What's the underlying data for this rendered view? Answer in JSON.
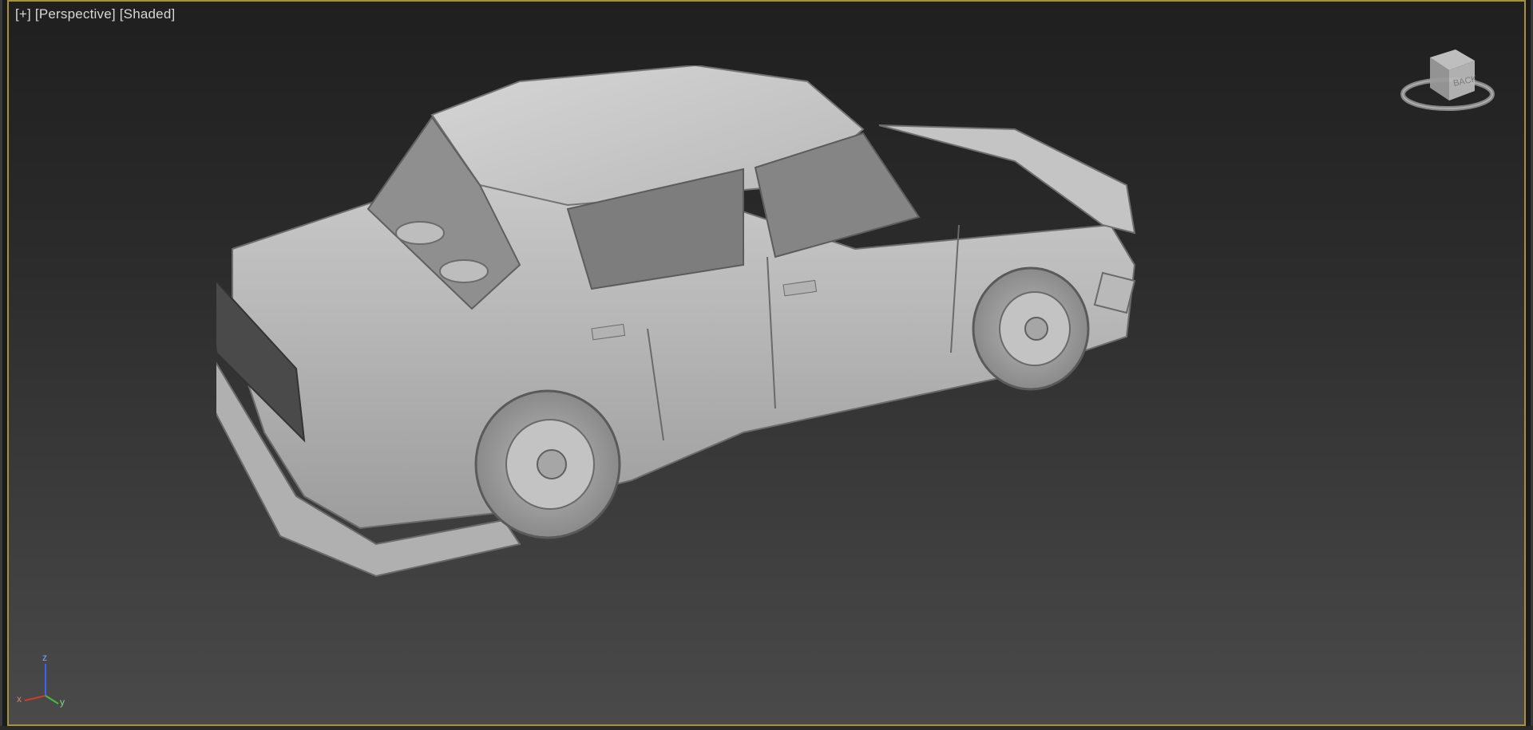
{
  "viewport": {
    "label_plus": "[+]",
    "label_view": "[Perspective]",
    "label_mode": "[Shaded]",
    "border_color": "#a8913a"
  },
  "viewcube": {
    "face_label": "BACK",
    "icon": "viewcube-icon"
  },
  "axis_tripod": {
    "x_label": "x",
    "y_label": "y",
    "z_label": "z",
    "x_color": "#d33a2c",
    "y_color": "#3fbf3f",
    "z_color": "#3a62ff"
  },
  "scene": {
    "object": "car-model-icon"
  }
}
